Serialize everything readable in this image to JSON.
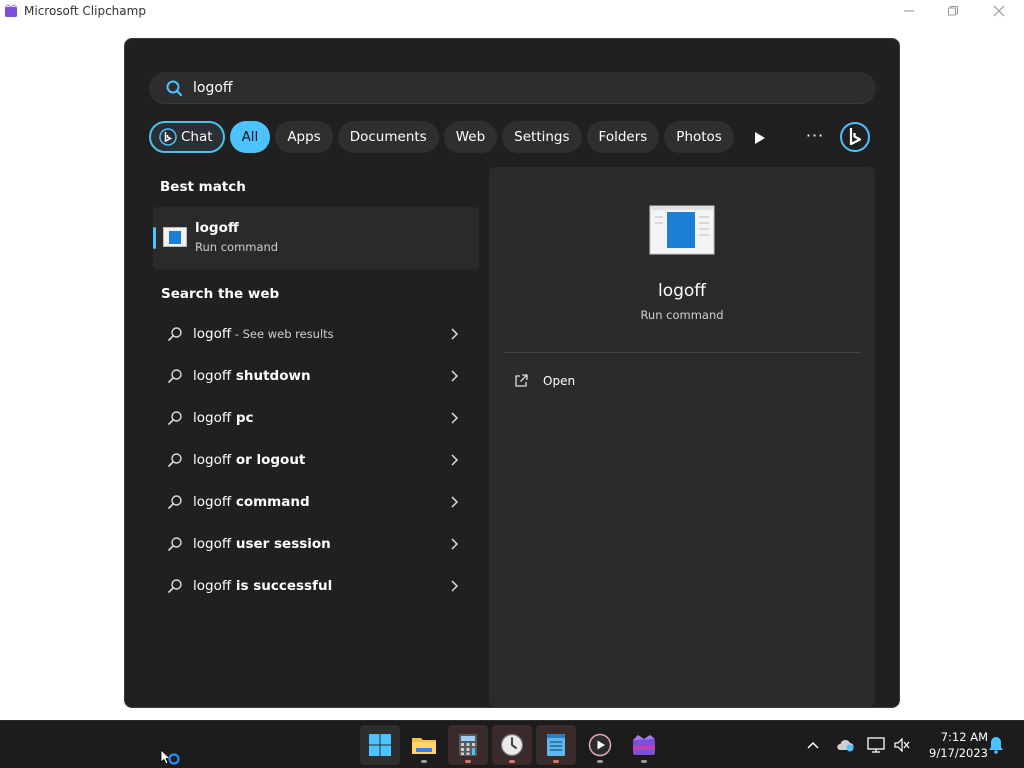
{
  "window": {
    "title": "Microsoft Clipchamp"
  },
  "search": {
    "query": "logoff"
  },
  "filters": [
    {
      "label": "Chat"
    },
    {
      "label": "All"
    },
    {
      "label": "Apps"
    },
    {
      "label": "Documents"
    },
    {
      "label": "Web"
    },
    {
      "label": "Settings"
    },
    {
      "label": "Folders"
    },
    {
      "label": "Photos"
    }
  ],
  "more_label": "···",
  "best_match": {
    "heading": "Best match",
    "title": "logoff",
    "subtitle": "Run command"
  },
  "web": {
    "heading": "Search the web",
    "items": [
      {
        "prefix": "logoff",
        "suffix": " - See web results"
      },
      {
        "prefix": "logoff",
        "suffix": " shutdown"
      },
      {
        "prefix": "logoff",
        "suffix": " pc"
      },
      {
        "prefix": "logoff",
        "suffix": " or logout"
      },
      {
        "prefix": "logoff",
        "suffix": " command"
      },
      {
        "prefix": "logoff",
        "suffix": " user session"
      },
      {
        "prefix": "logoff",
        "suffix": " is successful"
      }
    ]
  },
  "preview": {
    "title": "logoff",
    "subtitle": "Run command",
    "actions": [
      {
        "label": "Open"
      }
    ]
  },
  "clock": {
    "time": "7:12 AM",
    "date": "9/17/2023"
  },
  "colors": {
    "accent": "#4cc2ff",
    "panel": "#202020",
    "chip": "#2f2f2f"
  }
}
